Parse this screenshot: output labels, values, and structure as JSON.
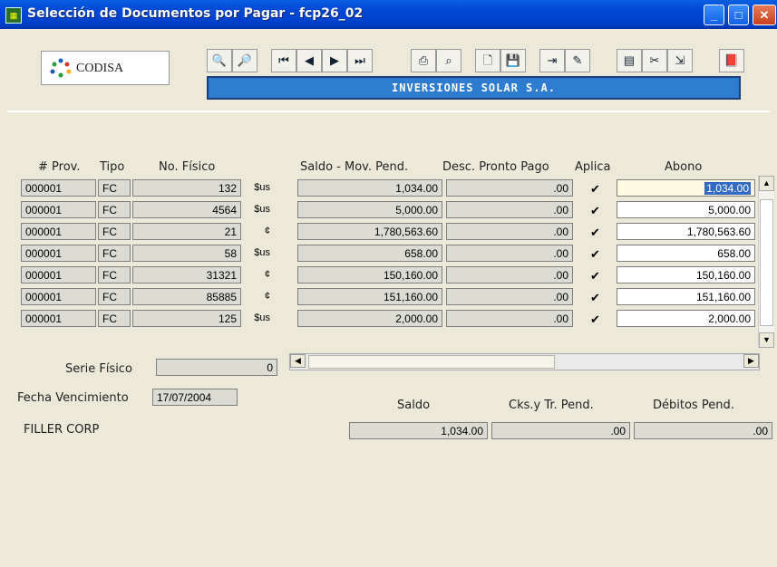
{
  "window": {
    "title": "Selección de Documentos por Pagar  -  fcp26_02"
  },
  "logo": {
    "text": "CODISA"
  },
  "company": "INVERSIONES SOLAR S.A.",
  "toolbar_icons": [
    "query-icon",
    "execute-query-icon",
    "first-record-icon",
    "prev-record-icon",
    "next-record-icon",
    "last-record-icon",
    "print-icon",
    "print-preview-icon",
    "new-record-icon",
    "save-icon",
    "insert-icon",
    "edit-icon",
    "clear-icon",
    "tools-icon",
    "exit-icon",
    "help-icon"
  ],
  "table": {
    "headers": {
      "prov": "# Prov.",
      "tipo": "Tipo",
      "fisico": "No. Físico",
      "saldo": "Saldo - Mov. Pend.",
      "desc": "Desc. Pronto Pago",
      "aplica": "Aplica",
      "abono": "Abono"
    },
    "rows": [
      {
        "prov": "000001",
        "tipo": "FC",
        "fisico": "132",
        "cur": "$us",
        "saldo": "1,034.00",
        "desc": ".00",
        "aplica": true,
        "abono": "1,034.00"
      },
      {
        "prov": "000001",
        "tipo": "FC",
        "fisico": "4564",
        "cur": "$us",
        "saldo": "5,000.00",
        "desc": ".00",
        "aplica": true,
        "abono": "5,000.00"
      },
      {
        "prov": "000001",
        "tipo": "FC",
        "fisico": "21",
        "cur": "¢",
        "saldo": "1,780,563.60",
        "desc": ".00",
        "aplica": true,
        "abono": "1,780,563.60"
      },
      {
        "prov": "000001",
        "tipo": "FC",
        "fisico": "58",
        "cur": "$us",
        "saldo": "658.00",
        "desc": ".00",
        "aplica": true,
        "abono": "658.00"
      },
      {
        "prov": "000001",
        "tipo": "FC",
        "fisico": "31321",
        "cur": "¢",
        "saldo": "150,160.00",
        "desc": ".00",
        "aplica": true,
        "abono": "150,160.00"
      },
      {
        "prov": "000001",
        "tipo": "FC",
        "fisico": "85885",
        "cur": "¢",
        "saldo": "151,160.00",
        "desc": ".00",
        "aplica": true,
        "abono": "151,160.00"
      },
      {
        "prov": "000001",
        "tipo": "FC",
        "fisico": "125",
        "cur": "$us",
        "saldo": "2,000.00",
        "desc": ".00",
        "aplica": true,
        "abono": "2,000.00"
      }
    ]
  },
  "form": {
    "serie_label": "Serie Físico",
    "serie_value": "0",
    "fecha_label": "Fecha Vencimiento",
    "fecha_value": "17/07/2004",
    "provider_name": "FILLER CORP",
    "saldo_label": "Saldo",
    "saldo_value": "1,034.00",
    "cks_label": "Cks.y Tr. Pend.",
    "cks_value": ".00",
    "debitos_label": "Débitos Pend.",
    "debitos_value": ".00"
  }
}
